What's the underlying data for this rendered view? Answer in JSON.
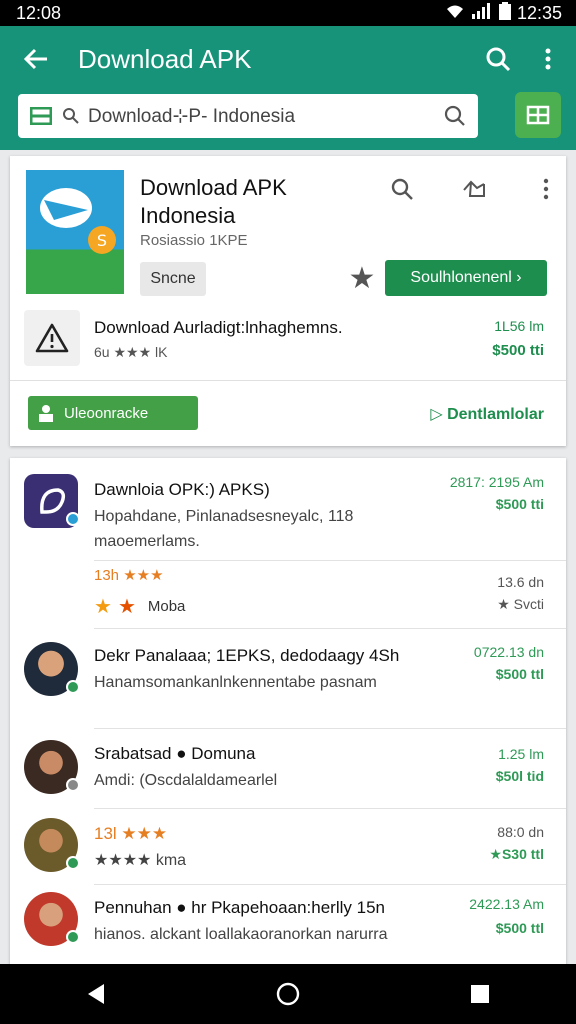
{
  "status_bar": {
    "time_left": "12:08",
    "time_right": "12:35",
    "wifi_icon": "wifi-icon",
    "signal_icon": "signal-icon",
    "battery_icon": "battery-icon"
  },
  "app_bar": {
    "title": "Download APK",
    "back_icon": "arrow-left-icon",
    "search_icon": "search-icon",
    "menu_icon": "more-vertical-icon"
  },
  "search": {
    "value": "Download⊹P- Indonesia",
    "scan_icon": "scan-icon"
  },
  "featured": {
    "title": "Download APK Indonesia",
    "subtitle": "Rosiassio 1KPE",
    "tag_label": "Sncne",
    "install_label": "Soulhlonenenl ›",
    "warning_title": "Download Aurladigt:lnhaghemns.",
    "warning_rating": "6u ★★★ lK",
    "warning_meta1": "1L56 lm",
    "warning_meta2": "$500 tti",
    "pill_label": "Uleoonracke",
    "download_link": "▷ Dentlamlolar"
  },
  "list": [
    {
      "title": "Dawnloia OPK:) APKS)",
      "desc": "Hopahdane, Pinlanadsesneyalc, 118 maoemerlams.",
      "meta1": "2817: 2195 Am",
      "meta2": "$500 tti",
      "rating1": "13h ★★★",
      "rating2": "Moba",
      "meta3": "13.6 dn",
      "meta4": "★ Svcti"
    },
    {
      "title": "Dekr Panalaaa; 1EPKS, dedodaagy 4Sh",
      "desc": "Hanamsomankanlnkennentabe pasnam",
      "meta1": "0722.13 dn",
      "meta2": "$500 ttl"
    },
    {
      "title": "Srabatsad ● Domuna",
      "desc": "Amdi: (Oscdalaldamearlel",
      "meta1": "1.25 lm",
      "meta2": "$50l tid"
    },
    {
      "title": "13l ★★★",
      "desc": "★★★★ kma",
      "meta1": "88:0 dn",
      "meta2": "★S30 ttl"
    },
    {
      "title": "Pennuhan ● hr Pkapehoaan:herlly 15n",
      "desc": "hianos. alckant loallakaoranorkan narurra",
      "meta1": "2422.13 Am",
      "meta2": "$500 ttl"
    }
  ],
  "nav": {
    "back": "nav-back-icon",
    "home": "nav-home-icon",
    "recents": "nav-recents-icon"
  },
  "colors": {
    "primary": "#17937a",
    "accent": "#4caf50",
    "install": "#1e8e4e",
    "star": "#f39c12"
  }
}
